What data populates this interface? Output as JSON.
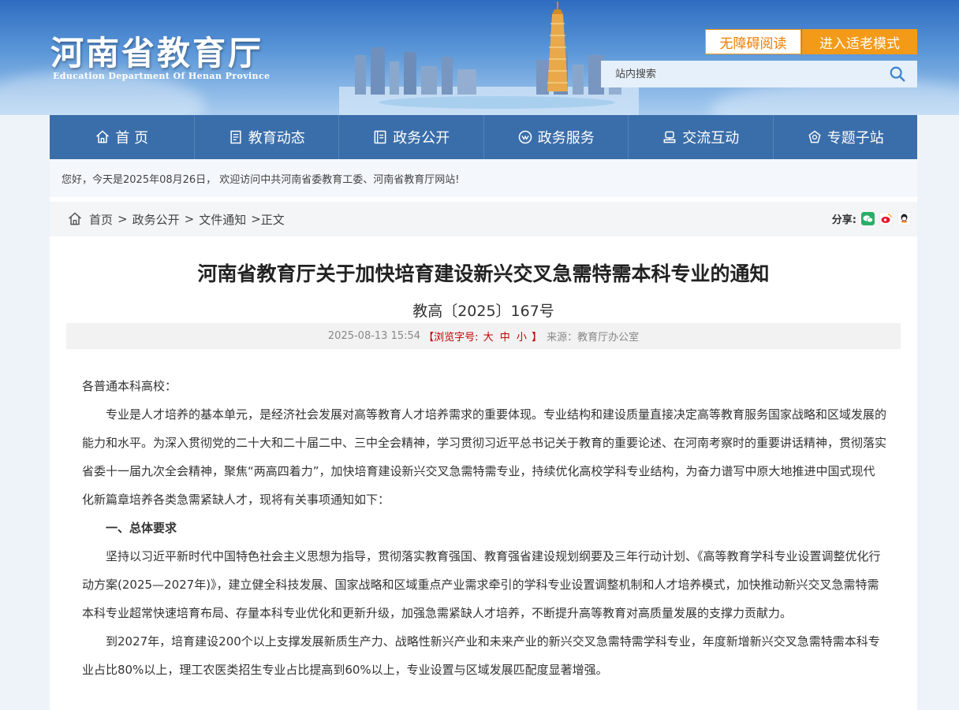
{
  "header": {
    "logo_title": "河南省教育厅",
    "logo_subtitle": "Education Department Of Henan Province",
    "accessibility_label": "无障碍阅读",
    "elder_mode_label": "进入适老模式",
    "search_placeholder": "站内搜索"
  },
  "nav": {
    "items": [
      {
        "label": "首 页",
        "icon": "home-icon"
      },
      {
        "label": "教育动态",
        "icon": "news-icon"
      },
      {
        "label": "政务公开",
        "icon": "book-icon"
      },
      {
        "label": "政务服务",
        "icon": "service-icon"
      },
      {
        "label": "交流互动",
        "icon": "interaction-icon"
      },
      {
        "label": "专题子站",
        "icon": "special-icon"
      }
    ]
  },
  "welcome_text": "您好，今天是2025年08月26日，  欢迎访问中共河南省委教育工委、河南省教育厅网站!",
  "breadcrumb": {
    "items": [
      "首页",
      "政务公开",
      "文件通知"
    ],
    "separator": ">",
    "current": "正文"
  },
  "share": {
    "label": "分享:",
    "icons": [
      "wechat-icon",
      "weibo-icon",
      "qq-icon"
    ]
  },
  "article": {
    "title": "河南省教育厅关于加快培育建设新兴交叉急需特需本科专业的通知",
    "doc_number": "教高〔2025〕167号",
    "date": "2025-08-13 15:54",
    "font_size_label": "【浏览字号:",
    "font_sizes": [
      "大",
      "中",
      "小"
    ],
    "font_size_close": "】",
    "source": "来源：教育厅办公室",
    "paragraphs": [
      "各普通本科高校：",
      "专业是人才培养的基本单元，是经济社会发展对高等教育人才培养需求的重要体现。专业结构和建设质量直接决定高等教育服务国家战略和区域发展的能力和水平。为深入贯彻党的二十大和二十届二中、三中全会精神，学习贯彻习近平总书记关于教育的重要论述、在河南考察时的重要讲话精神，贯彻落实省委十一届九次全会精神，聚焦“两高四着力”，加快培育建设新兴交叉急需特需专业，持续优化高校学科专业结构，为奋力谱写中原大地推进中国式现代化新篇章培养各类急需紧缺人才，现将有关事项通知如下：",
      "一、总体要求",
      "坚持以习近平新时代中国特色社会主义思想为指导，贯彻落实教育强国、教育强省建设规划纲要及三年行动计划、《高等教育学科专业设置调整优化行动方案(2025—2027年)》，建立健全科技发展、国家战略和区域重点产业需求牵引的学科专业设置调整机制和人才培养模式，加快推动新兴交叉急需特需本科专业超常快速培育布局、存量本科专业优化和更新升级，加强急需紧缺人才培养，不断提升高等教育对高质量发展的支撑力贡献力。",
      "到2027年，培育建设200个以上支撑发展新质生产力、战略性新兴产业和未来产业的新兴交叉急需特需学科专业，年度新增新兴交叉急需特需本科专业占比80%以上，理工农医类招生专业占比提高到60%以上，专业设置与区域发展匹配度显著增强。"
    ]
  },
  "colors": {
    "nav_bg": "#3a6eaa",
    "accent_orange": "#f49a19",
    "font_size_red": "#c00000"
  }
}
